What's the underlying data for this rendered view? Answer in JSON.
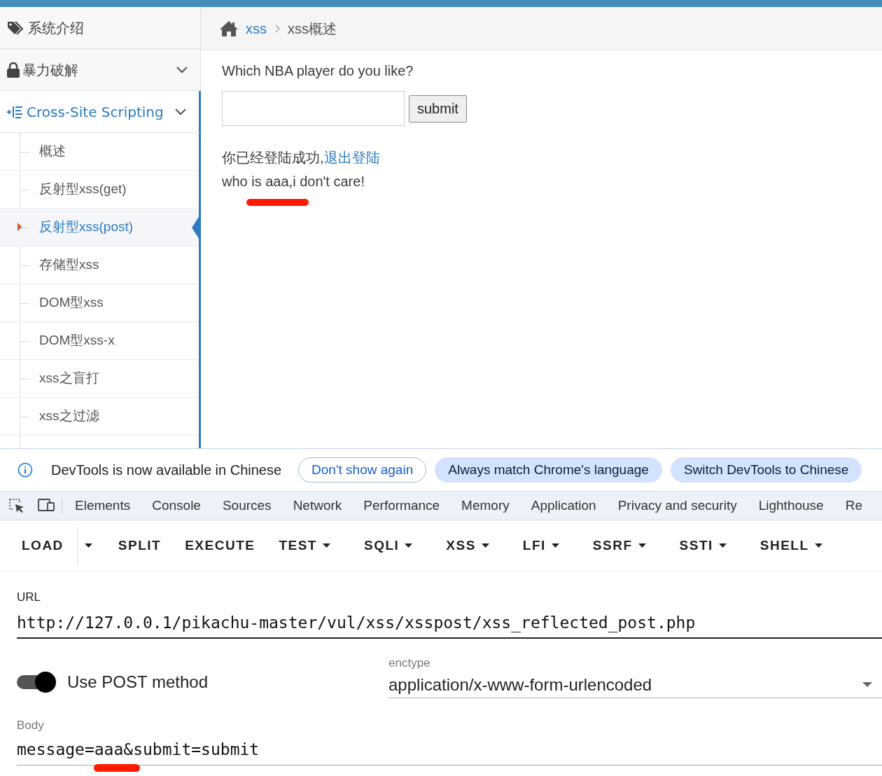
{
  "sidebar": {
    "items": [
      {
        "kind": "link",
        "label": "系统介绍"
      },
      {
        "kind": "group",
        "label": "暴力破解",
        "active": false
      },
      {
        "kind": "group",
        "label": "Cross-Site Scripting",
        "expanded": true,
        "active": true,
        "children": [
          {
            "label": "概述",
            "selected": false
          },
          {
            "label": "反射型xss(get)",
            "selected": false
          },
          {
            "label": "反射型xss(post)",
            "selected": true
          },
          {
            "label": "存储型xss",
            "selected": false
          },
          {
            "label": "DOM型xss",
            "selected": false
          },
          {
            "label": "DOM型xss-x",
            "selected": false
          },
          {
            "label": "xss之盲打",
            "selected": false
          },
          {
            "label": "xss之过滤",
            "selected": false
          }
        ]
      }
    ]
  },
  "breadcrumb": {
    "link": "xss",
    "current": "xss概述"
  },
  "form": {
    "question": "Which NBA player do you like?",
    "button": "submit"
  },
  "result": {
    "login_text": "你已经登陆成功,",
    "logout_link": "退出登陆",
    "message": "who is aaa,i don't care!"
  },
  "devtools": {
    "infobar": {
      "text": "DevTools is now available in Chinese",
      "buttons": [
        {
          "kind": "outline",
          "label": "Don't show again"
        },
        {
          "kind": "filled",
          "label": "Always match Chrome's language"
        },
        {
          "kind": "filled",
          "label": "Switch DevTools to Chinese"
        }
      ]
    },
    "tabs": [
      "Elements",
      "Console",
      "Sources",
      "Network",
      "Performance",
      "Memory",
      "Application",
      "Privacy and security",
      "Lighthouse",
      "Re"
    ]
  },
  "hackbar": {
    "buttons": [
      {
        "kind": "split",
        "label": "LOAD"
      },
      {
        "kind": "plain",
        "label": "SPLIT"
      },
      {
        "kind": "plain",
        "label": "EXECUTE"
      },
      {
        "kind": "dropdown",
        "label": "TEST"
      },
      {
        "kind": "dropdown",
        "label": "SQLI"
      },
      {
        "kind": "dropdown",
        "label": "XSS"
      },
      {
        "kind": "dropdown",
        "label": "LFI"
      },
      {
        "kind": "dropdown",
        "label": "SSRF"
      },
      {
        "kind": "dropdown",
        "label": "SSTI"
      },
      {
        "kind": "dropdown",
        "label": "SHELL"
      }
    ],
    "url_label": "URL",
    "url": "http://127.0.0.1/pikachu-master/vul/xss/xsspost/xss_reflected_post.php",
    "post_toggle": {
      "label": "Use POST method",
      "on": true
    },
    "enctype": {
      "label": "enctype",
      "value": "application/x-www-form-urlencoded"
    },
    "body_label": "Body",
    "body": "message=aaa&submit=submit"
  }
}
